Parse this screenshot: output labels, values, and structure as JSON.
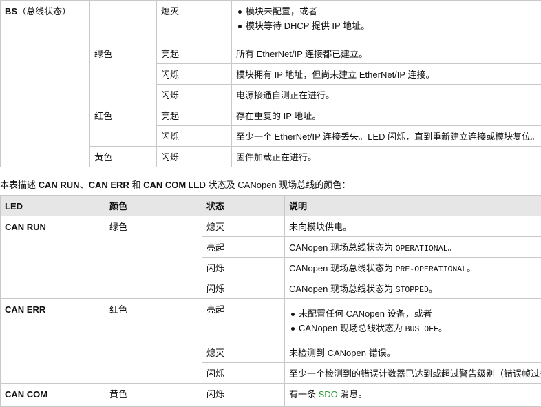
{
  "bs_table": {
    "led_label": "BS",
    "led_sub": "（总线状态）",
    "rows": [
      {
        "color": "–",
        "state": "熄灭",
        "bullets": [
          "模块未配置，或者",
          "模块等待 DHCP 提供 IP 地址。"
        ]
      },
      {
        "color": "绿色",
        "state": "亮起",
        "desc": "所有 EtherNet/IP 连接都已建立。"
      },
      {
        "state": "闪烁",
        "desc": "模块拥有 IP 地址，但尚未建立 EtherNet/IP 连接。"
      },
      {
        "state": "闪烁",
        "desc": "电源接通自测正在进行。"
      },
      {
        "color": "红色",
        "state": "亮起",
        "desc": "存在重复的 IP 地址。"
      },
      {
        "state": "闪烁",
        "desc": "至少一个 EtherNet/IP 连接丢失。LED 闪烁，直到重新建立连接或模块复位。"
      },
      {
        "color": "黄色",
        "state": "闪烁",
        "desc": "固件加载正在进行。"
      }
    ]
  },
  "intro": {
    "p1": "本表描述 ",
    "b1": "CAN RUN",
    "p2": "、",
    "b2": "CAN ERR",
    "p3": " 和 ",
    "b3": "CAN COM",
    "p4": " LED 状态及 CANopen 现场总线的颜色："
  },
  "can_table": {
    "headers": {
      "led": "LED",
      "color": "颜色",
      "state": "状态",
      "desc": "说明"
    },
    "can_run": {
      "name": "CAN RUN",
      "color": "绿色",
      "rows": [
        {
          "state": "熄灭",
          "desc": "未向模块供电。"
        },
        {
          "state": "亮起",
          "desc_prefix": "CANopen 现场总线状态为 ",
          "code": "OPERATIONAL",
          "desc_suffix": "。"
        },
        {
          "state": "闪烁",
          "desc_prefix": "CANopen 现场总线状态为 ",
          "code": "PRE-OPERATIONAL",
          "desc_suffix": "。"
        },
        {
          "state": "闪烁",
          "desc_prefix": "CANopen 现场总线状态为 ",
          "code": "STOPPED",
          "desc_suffix": "。"
        }
      ]
    },
    "can_err": {
      "name": "CAN ERR",
      "color": "红色",
      "rows": [
        {
          "state": "亮起",
          "bullet1": "未配置任何 CANopen 设备，或者",
          "bullet2_prefix": "CANopen 现场总线状态为 ",
          "bullet2_code": "BUS OFF",
          "bullet2_suffix": "。"
        },
        {
          "state": "熄灭",
          "desc": "未检测到 CANopen 错误。"
        },
        {
          "state": "闪烁",
          "desc": "至少一个检测到的错误计数器已达到或超过警告级别（错误帧过多）"
        }
      ]
    },
    "can_com": {
      "name": "CAN COM",
      "color": "黄色",
      "state": "闪烁",
      "desc_prefix": "有一条 ",
      "desc_link": "SDO",
      "desc_suffix": " 消息。"
    }
  },
  "colors": {
    "header_bg": "#e6e6e6",
    "border": "#c8c8c8",
    "link_green": "#2e9a3e"
  }
}
